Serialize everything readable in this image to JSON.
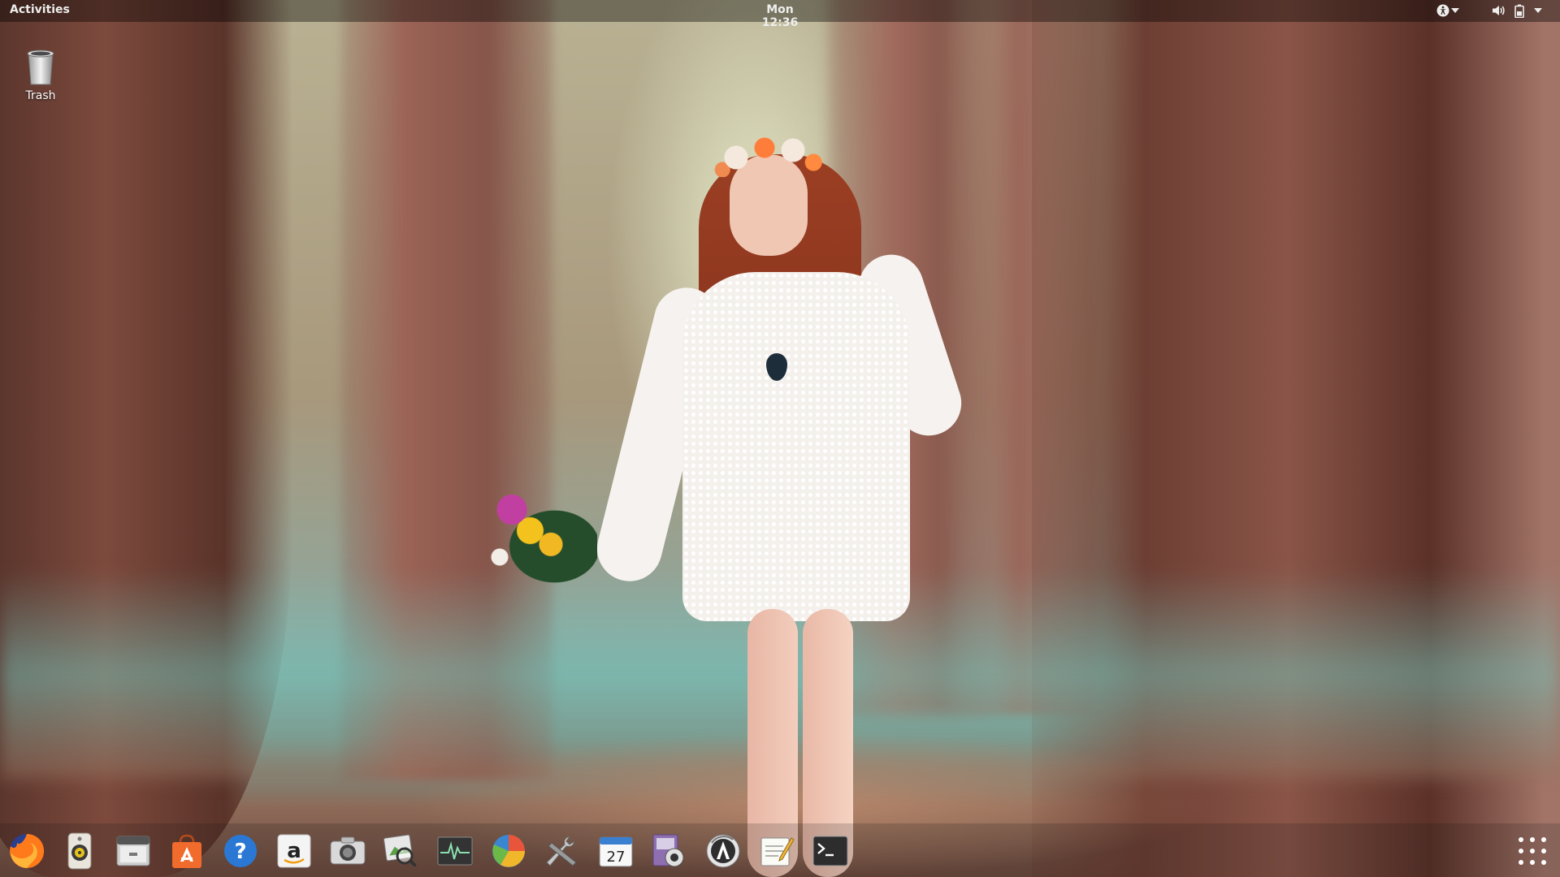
{
  "topbar": {
    "activities_label": "Activities",
    "clock": "Mon 12:36",
    "tray_icons": [
      "accessibility-icon",
      "volume-icon",
      "battery-icon"
    ]
  },
  "desktop": {
    "icons": [
      {
        "label": "Trash",
        "icon": "trash-icon"
      }
    ]
  },
  "dock": {
    "apps": [
      {
        "name": "Firefox",
        "icon": "firefox-icon"
      },
      {
        "name": "Rhythmbox",
        "icon": "speaker-icon"
      },
      {
        "name": "Files",
        "icon": "files-icon"
      },
      {
        "name": "Software Center",
        "icon": "software-center-icon"
      },
      {
        "name": "Help",
        "icon": "help-icon"
      },
      {
        "name": "Amazon",
        "icon": "amazon-icon"
      },
      {
        "name": "Screenshot",
        "icon": "camera-icon"
      },
      {
        "name": "Image Viewer",
        "icon": "image-viewer-icon"
      },
      {
        "name": "System Monitor",
        "icon": "system-monitor-icon"
      },
      {
        "name": "Disk Usage Analyzer",
        "icon": "disk-usage-icon"
      },
      {
        "name": "System Tools",
        "icon": "tools-icon"
      },
      {
        "name": "Calendar",
        "icon": "calendar-icon",
        "badge": "27"
      },
      {
        "name": "Cheese",
        "icon": "webcam-icon"
      },
      {
        "name": "Software Updater",
        "icon": "updater-icon"
      },
      {
        "name": "Text Editor",
        "icon": "text-editor-icon"
      },
      {
        "name": "Terminal",
        "icon": "terminal-icon"
      }
    ],
    "show_apps_icon": "app-grid-icon"
  },
  "colors": {
    "topbar_text": "#eeeeec",
    "firefox_orange": "#ff7a1a",
    "software_center_orange": "#f06b2c",
    "help_blue": "#2a78d4",
    "terminal_bg": "#2d2d2d"
  }
}
